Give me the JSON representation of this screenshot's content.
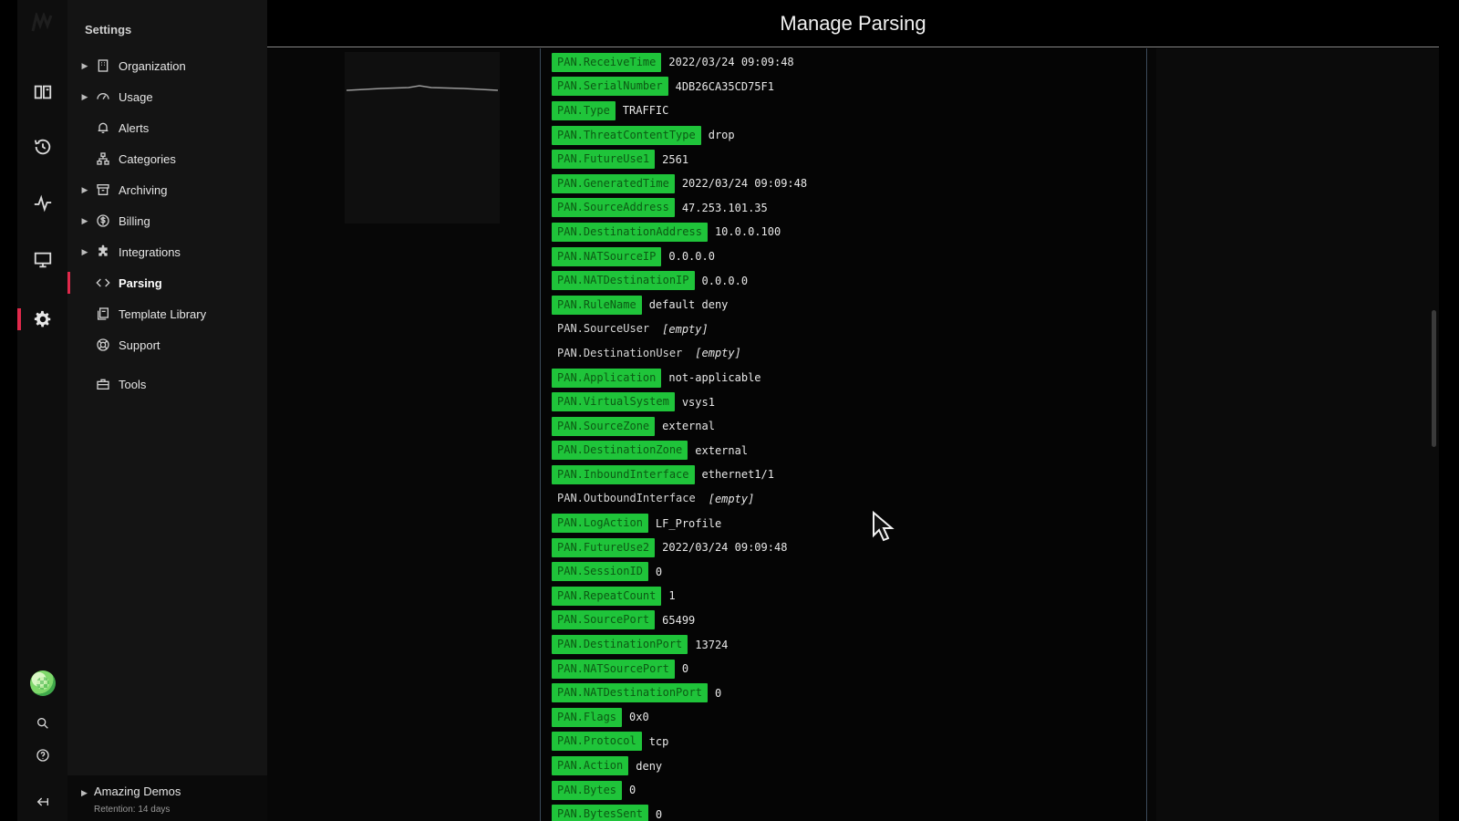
{
  "app": {
    "page_title": "Manage Parsing"
  },
  "rail": {
    "icons": [
      "logo-icon",
      "dashboards-icon",
      "history-icon",
      "pulse-icon",
      "monitor-icon",
      "gear-icon",
      "avatar",
      "search-icon",
      "help-icon",
      "collapse-icon"
    ],
    "active": "gear-icon",
    "accent_color": "#e0294b"
  },
  "settings": {
    "title": "Settings",
    "items": [
      {
        "label": "Organization",
        "icon": "building-icon",
        "expandable": true
      },
      {
        "label": "Usage",
        "icon": "gauge-icon",
        "expandable": true
      },
      {
        "label": "Alerts",
        "icon": "bell-icon",
        "expandable": false
      },
      {
        "label": "Categories",
        "icon": "hierarchy-icon",
        "expandable": false
      },
      {
        "label": "Archiving",
        "icon": "archive-icon",
        "expandable": true
      },
      {
        "label": "Billing",
        "icon": "dollar-icon",
        "expandable": true
      },
      {
        "label": "Integrations",
        "icon": "puzzle-icon",
        "expandable": true
      },
      {
        "label": "Parsing",
        "icon": "code-icon",
        "expandable": false,
        "active": true
      },
      {
        "label": "Template Library",
        "icon": "library-icon",
        "expandable": false
      },
      {
        "label": "Support",
        "icon": "lifebuoy-icon",
        "expandable": false
      },
      {
        "label": "Tools",
        "icon": "toolbox-icon",
        "expandable": false
      }
    ],
    "footer": {
      "title": "Amazing Demos",
      "subtitle": "Retention: 14 days"
    }
  },
  "fields": [
    {
      "key": "PAN.ReceiveTime",
      "value": "2022/03/24 09:09:48",
      "parsed": true
    },
    {
      "key": "PAN.SerialNumber",
      "value": "4DB26CA35CD75F1",
      "parsed": true
    },
    {
      "key": "PAN.Type",
      "value": "TRAFFIC",
      "parsed": true
    },
    {
      "key": "PAN.ThreatContentType",
      "value": "drop",
      "parsed": true
    },
    {
      "key": "PAN.FutureUse1",
      "value": "2561",
      "parsed": true
    },
    {
      "key": "PAN.GeneratedTime",
      "value": "2022/03/24 09:09:48",
      "parsed": true
    },
    {
      "key": "PAN.SourceAddress",
      "value": "47.253.101.35",
      "parsed": true
    },
    {
      "key": "PAN.DestinationAddress",
      "value": "10.0.0.100",
      "parsed": true
    },
    {
      "key": "PAN.NATSourceIP",
      "value": "0.0.0.0",
      "parsed": true
    },
    {
      "key": "PAN.NATDestinationIP",
      "value": "0.0.0.0",
      "parsed": true
    },
    {
      "key": "PAN.RuleName",
      "value": "default deny",
      "parsed": true
    },
    {
      "key": "PAN.SourceUser",
      "value": "[empty]",
      "parsed": false
    },
    {
      "key": "PAN.DestinationUser",
      "value": "[empty]",
      "parsed": false
    },
    {
      "key": "PAN.Application",
      "value": "not-applicable",
      "parsed": true
    },
    {
      "key": "PAN.VirtualSystem",
      "value": "vsys1",
      "parsed": true
    },
    {
      "key": "PAN.SourceZone",
      "value": "external",
      "parsed": true
    },
    {
      "key": "PAN.DestinationZone",
      "value": "external",
      "parsed": true
    },
    {
      "key": "PAN.InboundInterface",
      "value": "ethernet1/1",
      "parsed": true
    },
    {
      "key": "PAN.OutboundInterface",
      "value": "[empty]",
      "parsed": false
    },
    {
      "key": "PAN.LogAction",
      "value": "LF_Profile",
      "parsed": true
    },
    {
      "key": "PAN.FutureUse2",
      "value": "2022/03/24 09:09:48",
      "parsed": true
    },
    {
      "key": "PAN.SessionID",
      "value": "0",
      "parsed": true
    },
    {
      "key": "PAN.RepeatCount",
      "value": "1",
      "parsed": true
    },
    {
      "key": "PAN.SourcePort",
      "value": "65499",
      "parsed": true
    },
    {
      "key": "PAN.DestinationPort",
      "value": "13724",
      "parsed": true
    },
    {
      "key": "PAN.NATSourcePort",
      "value": "0",
      "parsed": true
    },
    {
      "key": "PAN.NATDestinationPort",
      "value": "0",
      "parsed": true
    },
    {
      "key": "PAN.Flags",
      "value": "0x0",
      "parsed": true
    },
    {
      "key": "PAN.Protocol",
      "value": "tcp",
      "parsed": true
    },
    {
      "key": "PAN.Action",
      "value": "deny",
      "parsed": true
    },
    {
      "key": "PAN.Bytes",
      "value": "0",
      "parsed": true
    },
    {
      "key": "PAN.BytesSent",
      "value": "0",
      "parsed": true
    }
  ],
  "colors": {
    "parsed_key_bg": "#1fc43a",
    "parsed_key_text": "#0c5a14"
  }
}
